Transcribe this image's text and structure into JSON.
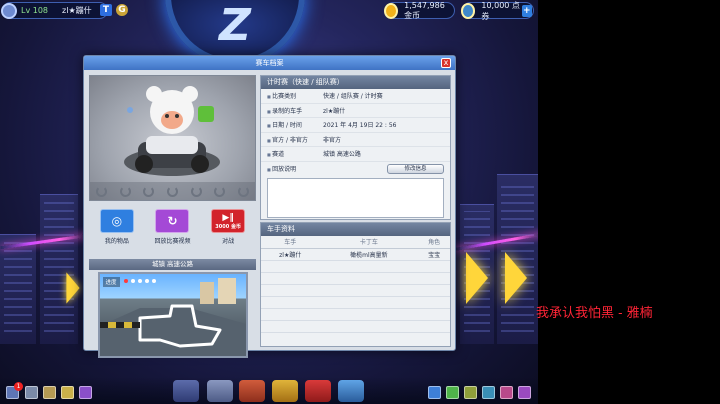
{
  "hud": {
    "level": "Lv 108",
    "player_name": "zl★蹦什",
    "gold_amount": "1,547,986 金币",
    "points_amount": "10,000 点券",
    "badge_count": "1"
  },
  "dialog": {
    "title": "赛车档案",
    "close": "x"
  },
  "left": {
    "actions": [
      {
        "label": "我的物品",
        "color": "#2f7fe0"
      },
      {
        "label": "回放比赛视频",
        "color": "#a449d6"
      },
      {
        "label": "对战",
        "color": "#d2232b",
        "cost": "3000 金币"
      }
    ],
    "track_header": "城镇 高速公路",
    "progress_label": "进度"
  },
  "timing": {
    "title": "计时赛（快速 / 组队赛）",
    "rows": [
      {
        "label": "比赛类别",
        "value": "快速 / 组队赛 / 计时赛"
      },
      {
        "label": "录制的车手",
        "value": "zl★蹦什"
      },
      {
        "label": "日期 / 时间",
        "value": "2021 年 4月 19日 22 : 56"
      },
      {
        "label": "官方 / 非官方",
        "value": "非官方"
      },
      {
        "label": "赛道",
        "value": "城镇 高速公路"
      },
      {
        "label": "回放说明",
        "value": ""
      }
    ],
    "modify_button": "修改信息"
  },
  "drivers": {
    "title": "车手资料",
    "headers": [
      "车手",
      "卡丁车",
      "角色"
    ],
    "rows": [
      [
        "zl★蹦什",
        "橄榄ml高量新",
        "宝宝"
      ]
    ]
  },
  "marquee": "我承认我怕黑 - 雅楠"
}
